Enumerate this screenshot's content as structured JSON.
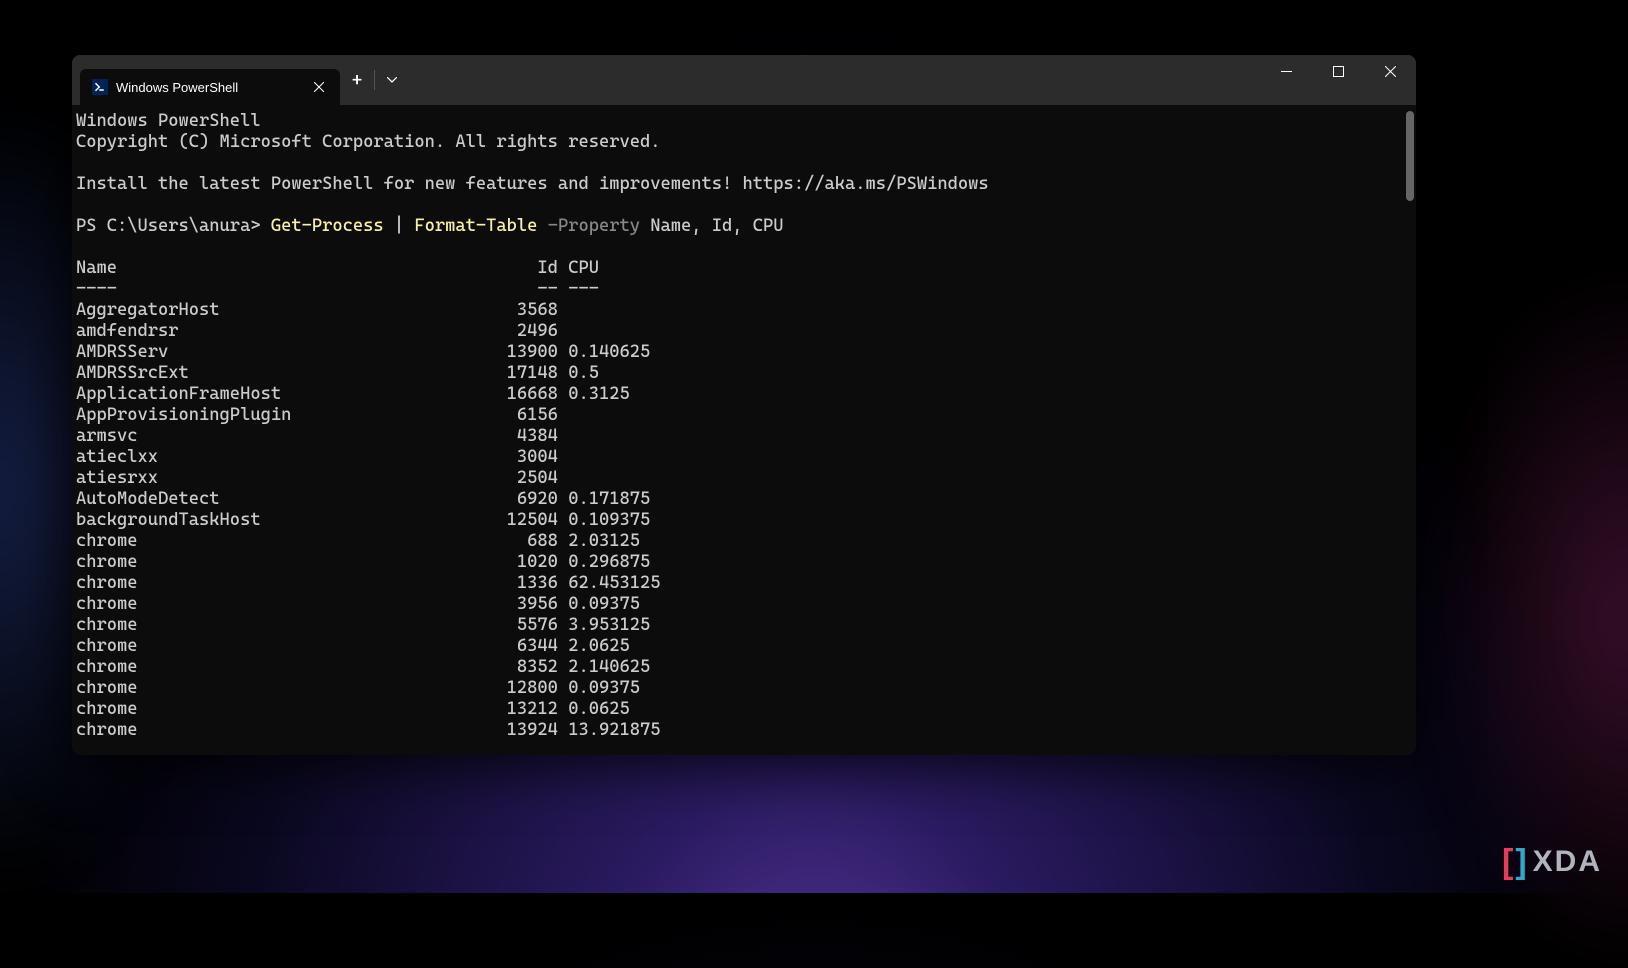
{
  "tab": {
    "title": "Windows PowerShell"
  },
  "headerLines": [
    "Windows PowerShell",
    "Copyright (C) Microsoft Corporation. All rights reserved.",
    "",
    "Install the latest PowerShell for new features and improvements! https://aka.ms/PSWindows",
    ""
  ],
  "prompt": {
    "prefix": "PS C:\\Users\\anura> ",
    "cmd1": "Get-Process",
    "mid1": " | ",
    "cmd2": "Format-Table",
    "param": " -Property",
    "args": " Name, Id, CPU"
  },
  "tableHeader": {
    "name": "Name",
    "id": "Id",
    "cpu": "CPU"
  },
  "tableDivider": {
    "name": "----",
    "id": "--",
    "cpu": "---"
  },
  "processes": [
    {
      "name": "AggregatorHost",
      "id": "3568",
      "cpu": ""
    },
    {
      "name": "amdfendrsr",
      "id": "2496",
      "cpu": ""
    },
    {
      "name": "AMDRSServ",
      "id": "13900",
      "cpu": "0.140625"
    },
    {
      "name": "AMDRSSrcExt",
      "id": "17148",
      "cpu": "0.5"
    },
    {
      "name": "ApplicationFrameHost",
      "id": "16668",
      "cpu": "0.3125"
    },
    {
      "name": "AppProvisioningPlugin",
      "id": "6156",
      "cpu": ""
    },
    {
      "name": "armsvc",
      "id": "4384",
      "cpu": ""
    },
    {
      "name": "atieclxx",
      "id": "3004",
      "cpu": ""
    },
    {
      "name": "atiesrxx",
      "id": "2504",
      "cpu": ""
    },
    {
      "name": "AutoModeDetect",
      "id": "6920",
      "cpu": "0.171875"
    },
    {
      "name": "backgroundTaskHost",
      "id": "12504",
      "cpu": "0.109375"
    },
    {
      "name": "chrome",
      "id": "688",
      "cpu": "2.03125"
    },
    {
      "name": "chrome",
      "id": "1020",
      "cpu": "0.296875"
    },
    {
      "name": "chrome",
      "id": "1336",
      "cpu": "62.453125"
    },
    {
      "name": "chrome",
      "id": "3956",
      "cpu": "0.09375"
    },
    {
      "name": "chrome",
      "id": "5576",
      "cpu": "3.953125"
    },
    {
      "name": "chrome",
      "id": "6344",
      "cpu": "2.0625"
    },
    {
      "name": "chrome",
      "id": "8352",
      "cpu": "2.140625"
    },
    {
      "name": "chrome",
      "id": "12800",
      "cpu": "0.09375"
    },
    {
      "name": "chrome",
      "id": "13212",
      "cpu": "0.0625"
    },
    {
      "name": "chrome",
      "id": "13924",
      "cpu": "13.921875"
    }
  ],
  "colWidths": {
    "name": 41,
    "id": 6
  },
  "watermark": "XDA"
}
